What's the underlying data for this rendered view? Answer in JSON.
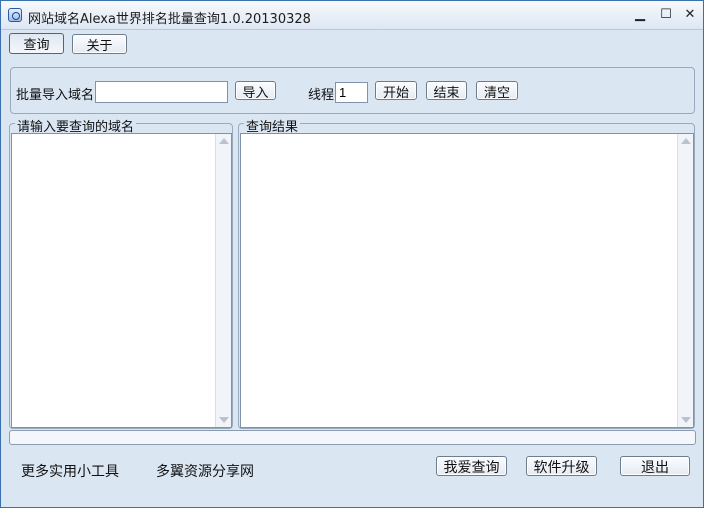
{
  "window": {
    "title": "网站域名Alexa世界排名批量查询1.0.20130328",
    "minimize_glyph": "▁",
    "maximize_glyph": "☐",
    "close_glyph": "✕",
    "icon": "app-globe-icon"
  },
  "tabs": [
    {
      "label": "查询",
      "selected": true
    },
    {
      "label": "关于",
      "selected": false
    }
  ],
  "import_bar": {
    "domain_label": "批量导入域名",
    "domain_value": "",
    "import_button": "导入",
    "threads_label": "线程",
    "threads_value": "1",
    "start_button": "开始",
    "stop_button": "结束",
    "clear_button": "清空"
  },
  "input_group": {
    "title": "请输入要查询的域名",
    "content": ""
  },
  "result_group": {
    "title": "查询结果",
    "content": ""
  },
  "progress": {
    "value_fraction": 0
  },
  "footer": {
    "more_tools": "更多实用小工具",
    "share_site": "多翼资源分享网",
    "love_query_button": "我爱查询",
    "upgrade_button": "软件升级",
    "exit_button": "退出"
  },
  "colors": {
    "frame": "#3c6fae",
    "background": "#dbe6f3"
  }
}
